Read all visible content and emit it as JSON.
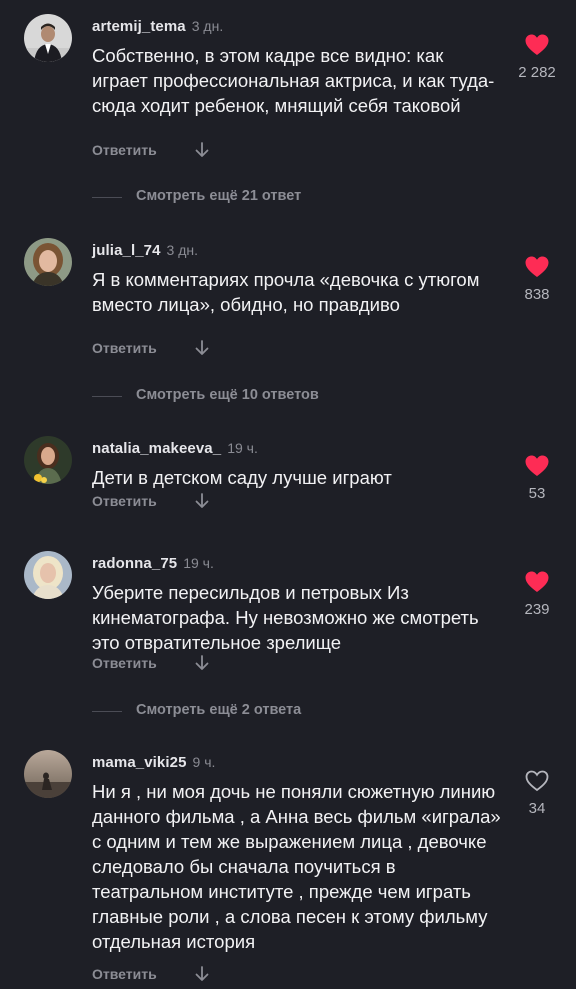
{
  "comments": [
    {
      "username": "artemij_tema",
      "time": "3 дн.",
      "text": "Собственно, в этом кадре все видно: как играет профессиональная актриса, и как туда-сюда ходит ребенок, мнящий себя таковой",
      "likes": "2 282",
      "liked": true,
      "reply_label": "Ответить"
    },
    {
      "username": "julia_l_74",
      "time": "3 дн.",
      "text": "Я в комментариях прочла «девочка с утюгом вместо лица», обидно, но правдиво",
      "likes": "838",
      "liked": true,
      "reply_label": "Ответить"
    },
    {
      "username": "natalia_makeeva_",
      "time": "19 ч.",
      "text": "Дети в детском саду лучше играют",
      "likes": "53",
      "liked": true,
      "reply_label": "Ответить"
    },
    {
      "username": "radonna_75",
      "time": "19 ч.",
      "text": "Уберите пересильдов и петровых Из кинематографа. Ну невозможно же смотреть это отвратительное зрелище",
      "likes": "239",
      "liked": true,
      "reply_label": "Ответить"
    },
    {
      "username": "mama_viki25",
      "time": "9 ч.",
      "text": "Ни я , ни моя дочь не поняли сюжетную линию данного фильма , а Анна весь фильм «играла» с одним и тем же выражением лица , девочке следовало бы сначала поучиться в театральном институте , прежде чем играть главные роли , а слова песен к этому фильму отдельная история",
      "likes": "34",
      "liked": false,
      "reply_label": "Ответить"
    }
  ],
  "more_replies": [
    "Смотреть ещё 21 ответ",
    "Смотреть ещё 10 ответов",
    "Смотреть ещё 2 ответа"
  ],
  "colors": {
    "background": "#1e1f26",
    "like_active": "#fe2c55",
    "secondary_text": "#8c8d95"
  },
  "icons": {
    "liked": "heart-filled-icon",
    "not_liked": "heart-outline-icon",
    "expand": "arrow-down-icon"
  }
}
